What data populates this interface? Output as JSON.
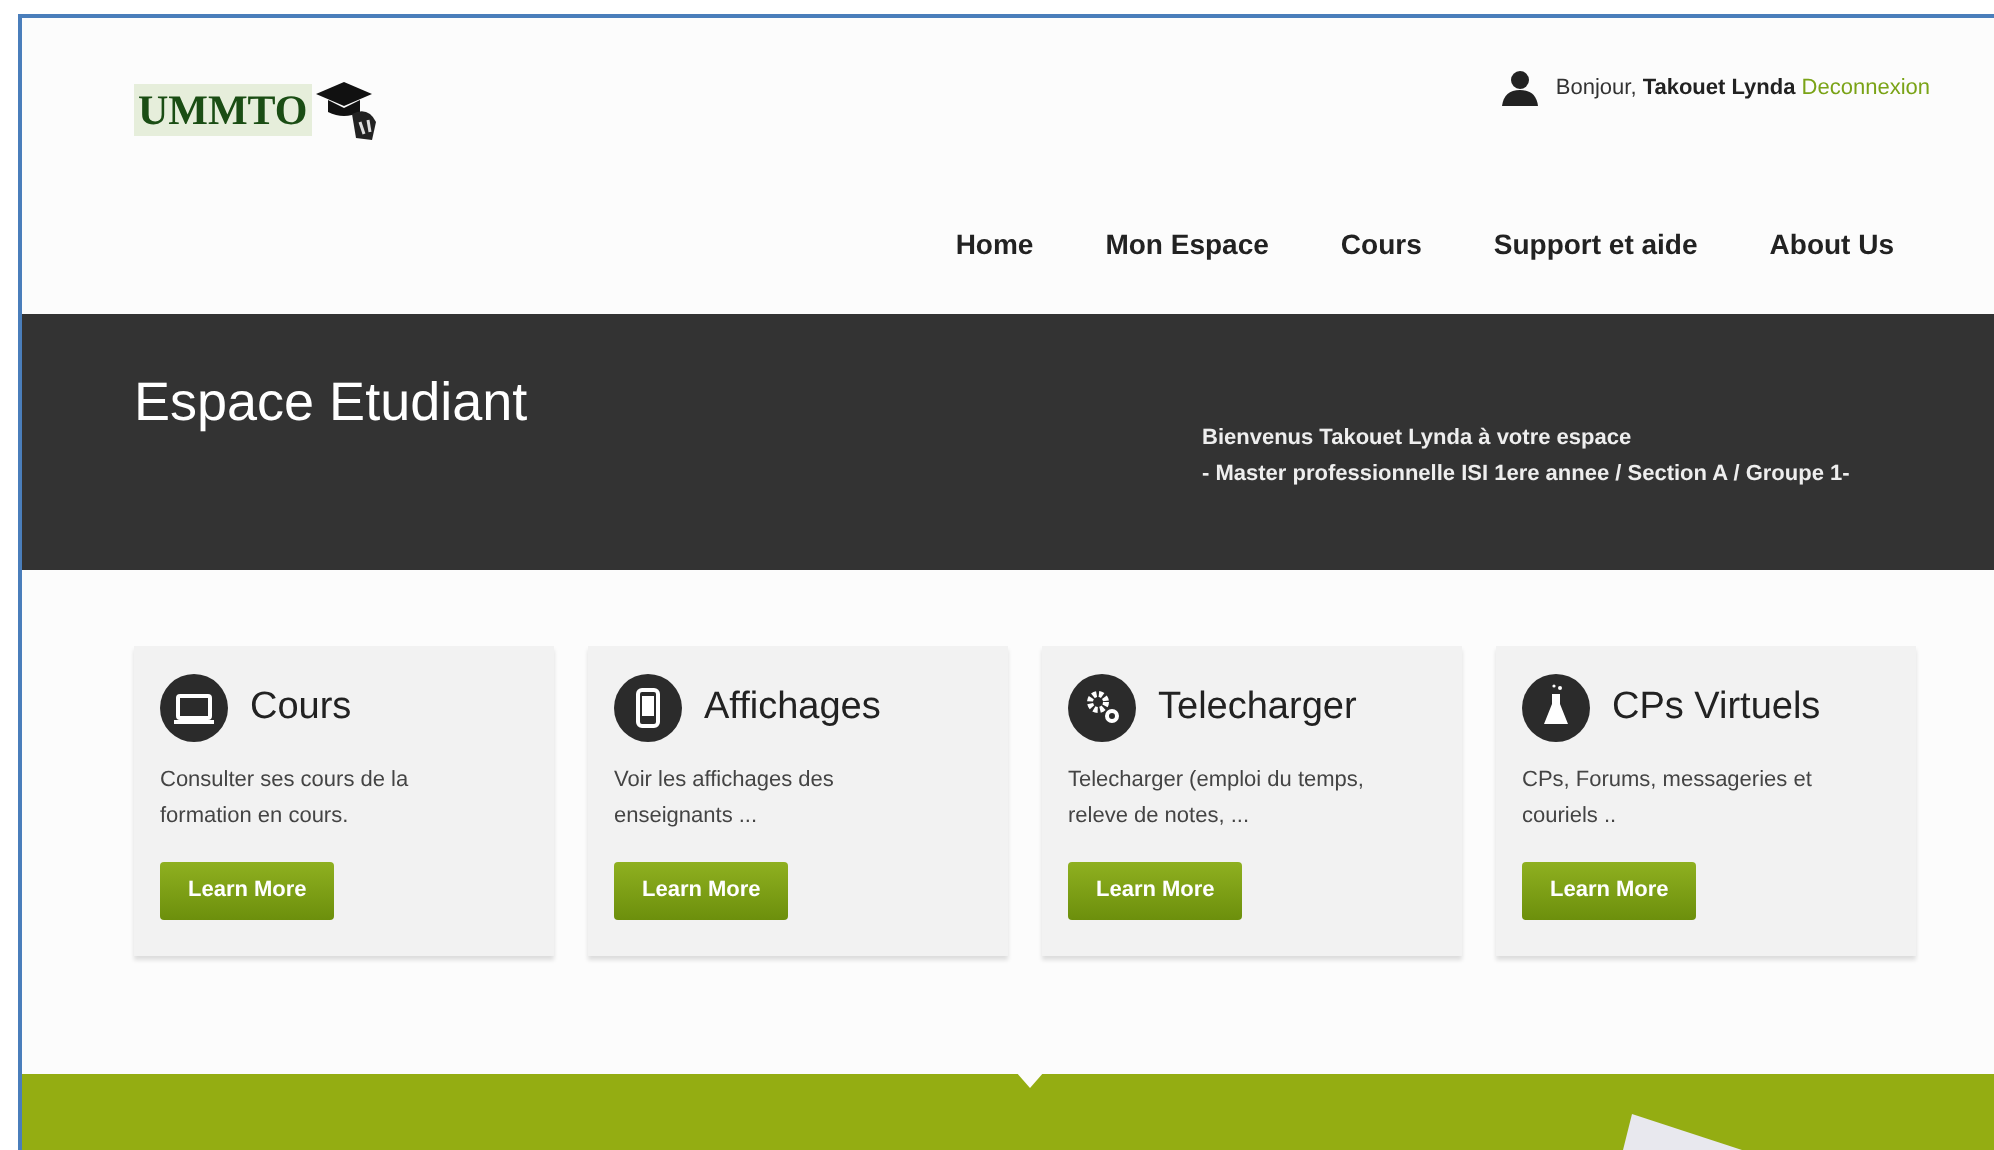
{
  "logo": {
    "text": "UMMTO"
  },
  "user_bar": {
    "greeting": "Bonjour,",
    "user_name": "Takouet Lynda",
    "logout_link": "Deconnexion"
  },
  "nav": [
    "Home",
    "Mon Espace",
    "Cours",
    "Support et aide",
    "About Us"
  ],
  "banner": {
    "title": "Espace Etudiant",
    "lines": [
      "Bienvenus Takouet Lynda à votre espace",
      "- Master professionnelle ISI 1ere annee / Section A / Groupe 1-"
    ]
  },
  "cards": [
    {
      "title": "Cours",
      "text": "Consulter ses cours de la formation en cours.",
      "button": "Learn More"
    },
    {
      "title": "Affichages",
      "text": "Voir les affichages des enseignants ...",
      "button": "Learn More"
    },
    {
      "title": "Telecharger",
      "text": "Telecharger (emploi du temps, releve de notes, ...",
      "button": "Learn More"
    },
    {
      "title": "CPs Virtuels",
      "text": "CPs, Forums, messageries et couriels ..",
      "button": "Learn More"
    }
  ]
}
